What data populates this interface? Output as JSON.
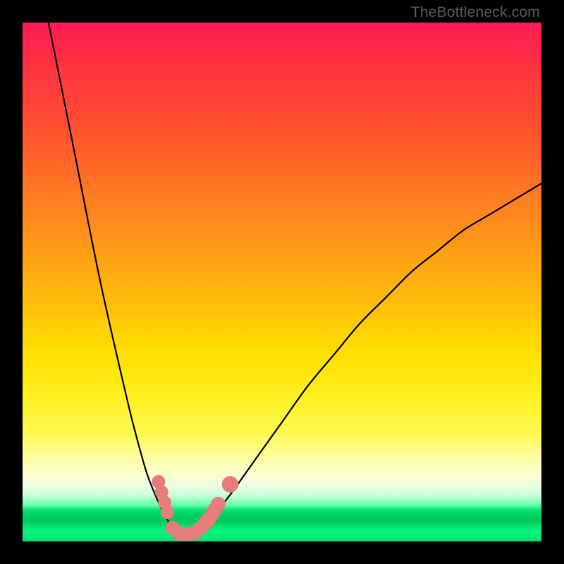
{
  "watermark": "TheBottleneck.com",
  "chart_data": {
    "type": "line",
    "title": "",
    "xlabel": "",
    "ylabel": "",
    "xlim": [
      0,
      100
    ],
    "ylim": [
      0,
      100
    ],
    "gradient_stops": [
      {
        "pos": 0,
        "color": "#ff1a56"
      },
      {
        "pos": 50,
        "color": "#ffe000"
      },
      {
        "pos": 88,
        "color": "#fcffc4"
      },
      {
        "pos": 94,
        "color": "#00e070"
      },
      {
        "pos": 100,
        "color": "#00e070"
      }
    ],
    "series": [
      {
        "name": "bottleneck-curve",
        "x": [
          5,
          10,
          15,
          20,
          22,
          24,
          26,
          28,
          29.5,
          31,
          32.5,
          34,
          36,
          40,
          45,
          50,
          55,
          60,
          65,
          70,
          75,
          80,
          85,
          90,
          95,
          100
        ],
        "values": [
          100,
          75,
          50,
          28,
          20,
          13,
          8,
          4,
          2,
          1.2,
          1.2,
          2,
          4,
          9,
          16,
          23,
          30,
          36,
          42,
          47,
          52,
          56,
          60,
          63,
          66,
          69
        ]
      }
    ],
    "markers": {
      "name": "highlighted-points",
      "color": "#e77c7c",
      "points": [
        {
          "x": 26.2,
          "y": 11.5,
          "r": 1.3
        },
        {
          "x": 26.8,
          "y": 9.5,
          "r": 1.3
        },
        {
          "x": 27.4,
          "y": 7.5,
          "r": 1.3
        },
        {
          "x": 27.9,
          "y": 5.6,
          "r": 1.3
        },
        {
          "x": 28.9,
          "y": 2.6,
          "r": 1.4
        },
        {
          "x": 30.2,
          "y": 1.5,
          "r": 1.4
        },
        {
          "x": 31.6,
          "y": 1.4,
          "r": 1.4
        },
        {
          "x": 33.0,
          "y": 1.6,
          "r": 1.4
        },
        {
          "x": 34.1,
          "y": 2.4,
          "r": 1.4
        },
        {
          "x": 35.0,
          "y": 3.3,
          "r": 1.4
        },
        {
          "x": 35.8,
          "y": 4.2,
          "r": 1.4
        },
        {
          "x": 36.5,
          "y": 5.2,
          "r": 1.4
        },
        {
          "x": 37.1,
          "y": 6.2,
          "r": 1.4
        },
        {
          "x": 37.7,
          "y": 7.2,
          "r": 1.4
        },
        {
          "x": 40.0,
          "y": 11.0,
          "r": 1.6
        }
      ]
    }
  }
}
